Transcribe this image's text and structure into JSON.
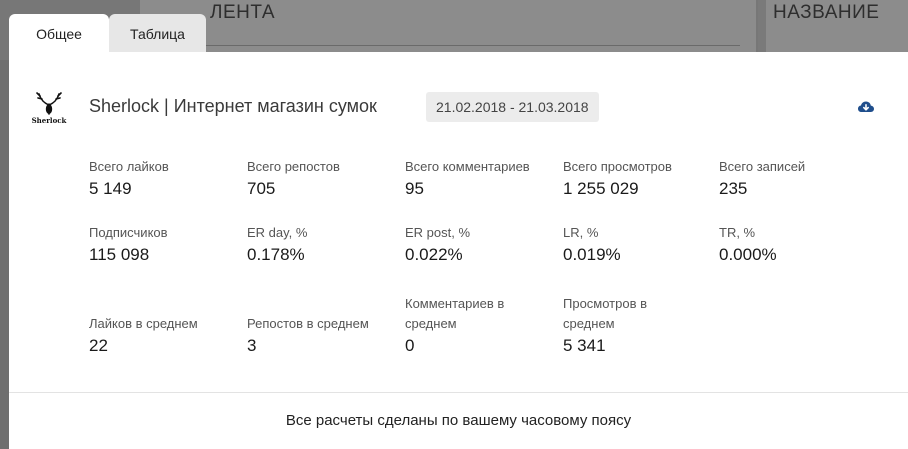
{
  "background": {
    "left_heading": "ЛЕНТА",
    "right_heading": "НАЗВАНИЕ"
  },
  "tabs": [
    {
      "label": "Общее",
      "active": true
    },
    {
      "label": "Таблица",
      "active": false
    }
  ],
  "community": {
    "logo_text": "Sherlock",
    "name": "Sherlock | Интернет магазин сумок",
    "date_range": "21.02.2018 - 21.03.2018"
  },
  "icons": {
    "download": "cloud-download-icon"
  },
  "colors": {
    "accent": "#1f4e8c",
    "overlay": "#6f6f6f"
  },
  "stats": {
    "row1": [
      {
        "label": "Всего лайков",
        "value": "5 149"
      },
      {
        "label": "Всего репостов",
        "value": "705"
      },
      {
        "label": "Всего комментариев",
        "value": "95"
      },
      {
        "label": "Всего просмотров",
        "value": "1 255 029"
      },
      {
        "label": "Всего записей",
        "value": "235"
      }
    ],
    "row2": [
      {
        "label": "Подписчиков",
        "value": "115 098"
      },
      {
        "label": "ER day, %",
        "value": "0.178%"
      },
      {
        "label": "ER post, %",
        "value": "0.022%"
      },
      {
        "label": "LR, %",
        "value": "0.019%"
      },
      {
        "label": "TR, %",
        "value": "0.000%"
      }
    ],
    "row3": [
      {
        "label": "Лайков в среднем",
        "value": "22"
      },
      {
        "label": "Репостов в среднем",
        "value": "3"
      },
      {
        "label": "Комментариев в среднем",
        "value": "0"
      },
      {
        "label": "Просмотров в среднем",
        "value": "5 341"
      }
    ]
  },
  "footer": {
    "note": "Все расчеты сделаны по вашему часовому поясу"
  }
}
